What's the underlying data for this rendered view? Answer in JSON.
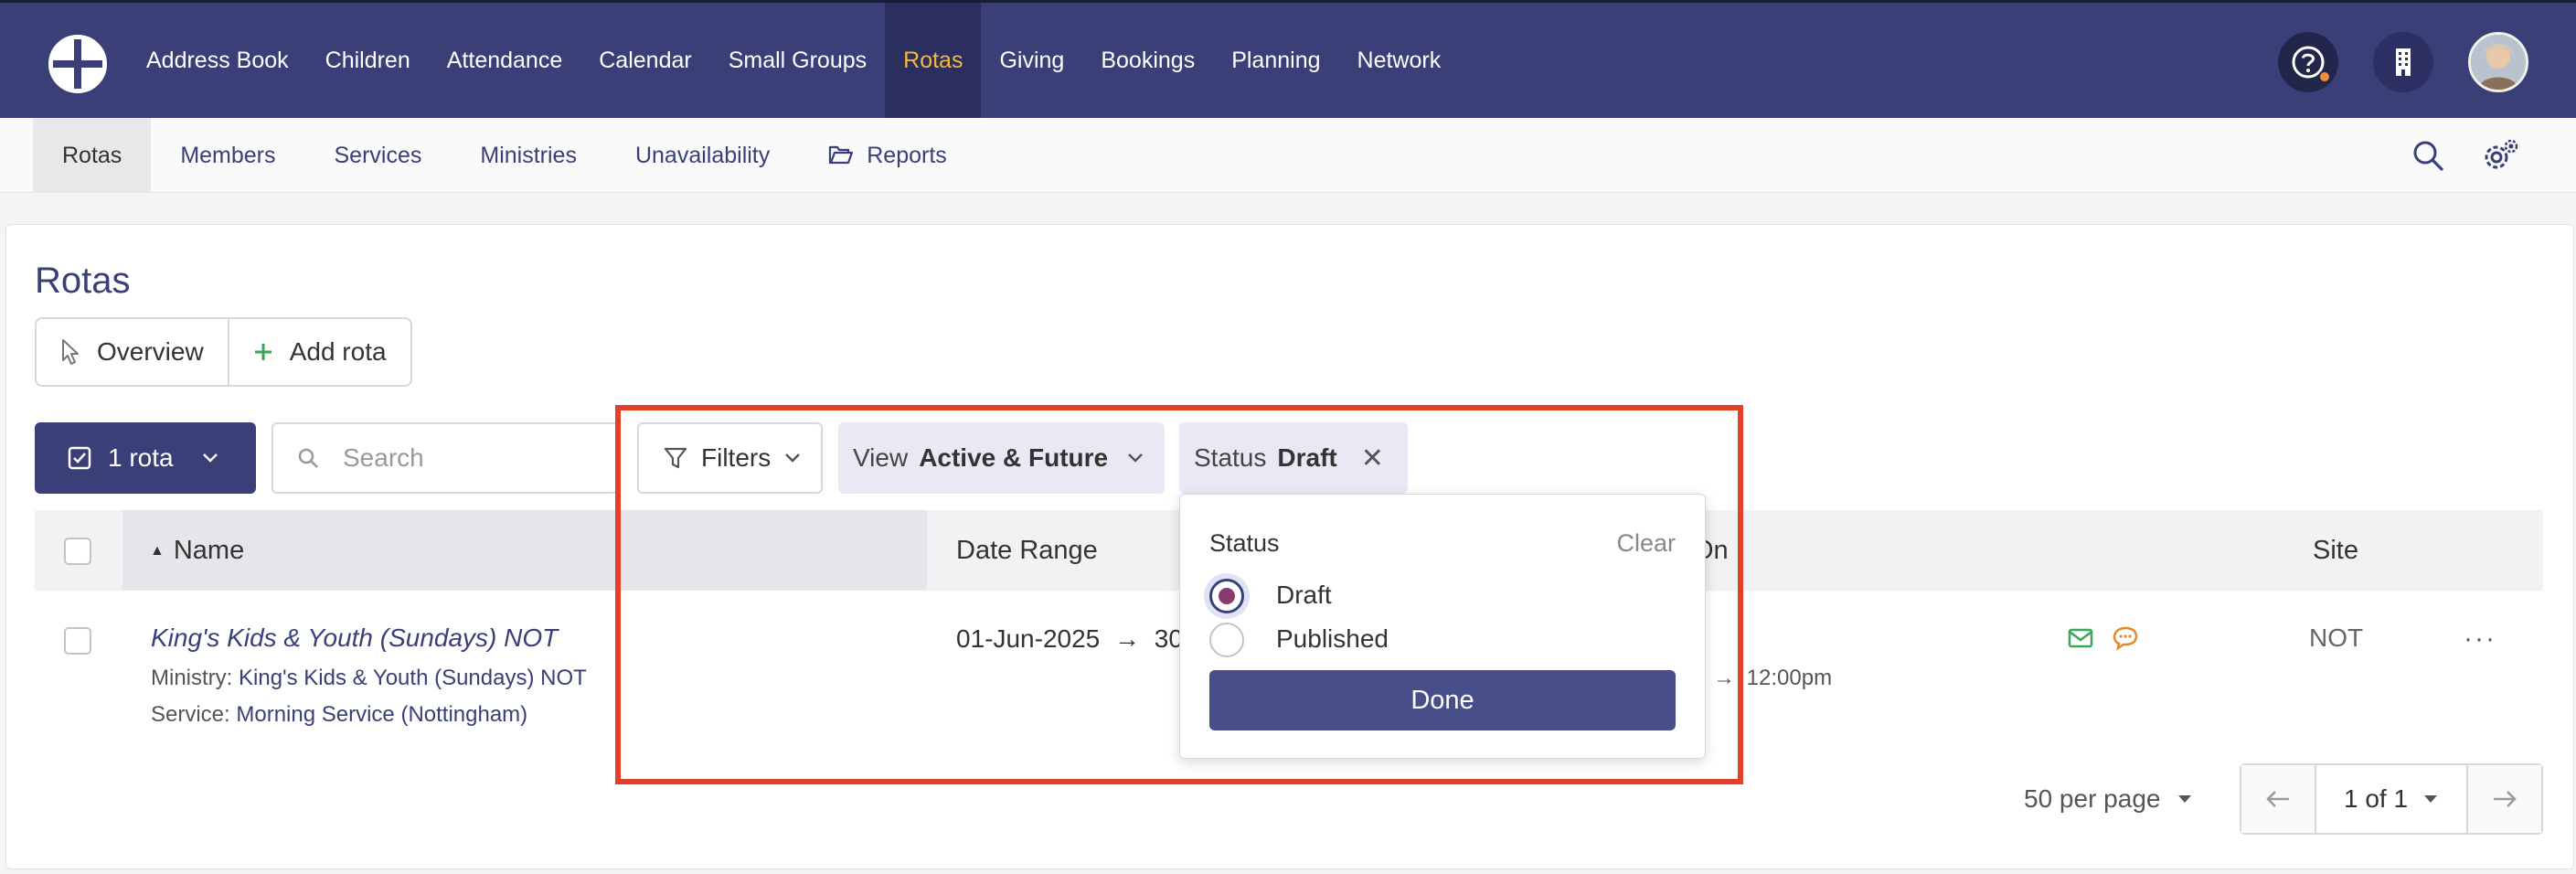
{
  "topnav": {
    "items": [
      "Address Book",
      "Children",
      "Attendance",
      "Calendar",
      "Small Groups",
      "Rotas",
      "Giving",
      "Bookings",
      "Planning",
      "Network"
    ],
    "active_index": 5
  },
  "subnav": {
    "items": [
      "Rotas",
      "Members",
      "Services",
      "Ministries",
      "Unavailability",
      "Reports"
    ],
    "active_index": 0
  },
  "page": {
    "title": "Rotas",
    "overview_label": "Overview",
    "add_rota_label": "Add rota"
  },
  "toolbar": {
    "selection_label": "1 rota",
    "search_placeholder": "Search",
    "filters_label": "Filters",
    "view_key": "View",
    "view_value": "Active & Future",
    "status_key": "Status",
    "status_value": "Draft"
  },
  "table": {
    "headers": {
      "name": "Name",
      "date_range": "Date Range",
      "on": "On",
      "site": "Site"
    },
    "row": {
      "title": "King's Kids & Youth (Sundays) NOT",
      "ministry_key": "Ministry:",
      "ministry_value": "King's Kids & Youth (Sundays) NOT",
      "service_key": "Service:",
      "service_value": "Morning Service (Nottingham)",
      "date_start": "01-Jun-2025",
      "date_arrow": "→",
      "date_end_partial": "30",
      "time_arrow": "→",
      "time_end": "12:00pm",
      "site": "NOT",
      "more": "···"
    }
  },
  "pagination": {
    "per_page": "50 per page",
    "page": "1 of 1"
  },
  "status_popover": {
    "heading": "Status",
    "clear_label": "Clear",
    "options": [
      "Draft",
      "Published"
    ],
    "selected": "Draft",
    "done_label": "Done"
  },
  "colors": {
    "nav_bg": "#3a3f78",
    "nav_active_text": "#f1b93a",
    "highlight": "#e2402b",
    "email_icon": "#3aa657",
    "chat_icon": "#e08a2c"
  }
}
